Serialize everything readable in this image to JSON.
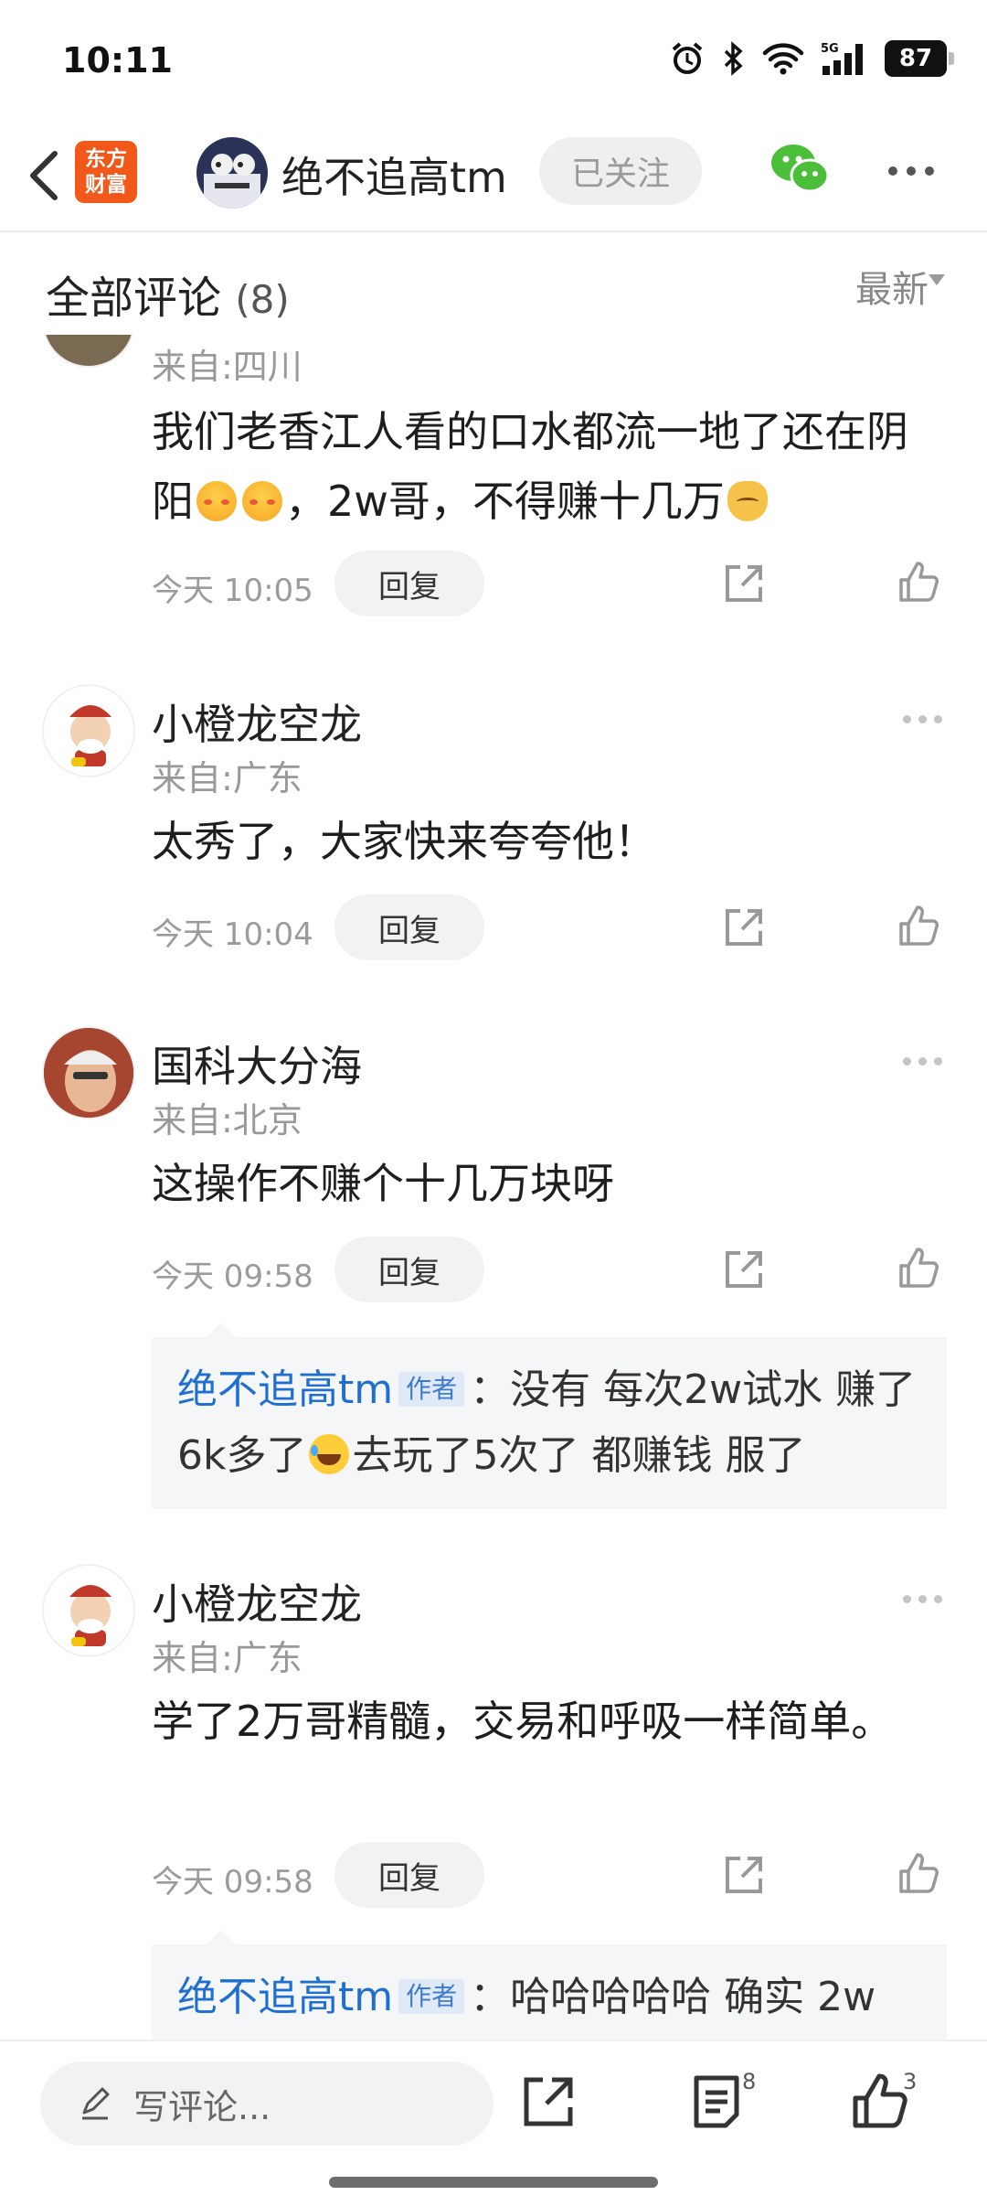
{
  "status_bar": {
    "time": "10:11",
    "network": "5G",
    "battery": "87"
  },
  "nav": {
    "app_logo_line1": "东方",
    "app_logo_line2": "财富",
    "author_name": "绝不追高tm",
    "follow_label": "已关注"
  },
  "comments_header": {
    "title": "全部评论",
    "count": "(8)",
    "sort_label": "最新"
  },
  "comments": [
    {
      "name": "",
      "location": "来自:四川",
      "text": "我们老香江人看的口水都流一地了还在阴阳",
      "text_tail": "，2w哥，不得赚十几万",
      "time": "今天 10:05",
      "reply_label": "回复"
    },
    {
      "name": "小橙龙空龙",
      "location": "来自:广东",
      "text": "太秀了，大家快来夸夸他！",
      "time": "今天 10:04",
      "reply_label": "回复"
    },
    {
      "name": "国科大分海",
      "location": "来自:北京",
      "text": "这操作不赚个十几万块呀",
      "time": "今天 09:58",
      "reply_label": "回复",
      "reply": {
        "author": "绝不追高tm",
        "tag": "作者",
        "text_a": "：没有 每次2w试水 赚了6k多了",
        "text_b": "去玩了5次了 都赚钱 服了"
      }
    },
    {
      "name": "小橙龙空龙",
      "location": "来自:广东",
      "text": "学了2万哥精髓，交易和呼吸一样简单。",
      "time": "今天 09:58",
      "reply_label": "回复",
      "reply": {
        "author": "绝不追高tm",
        "tag": "作者",
        "text_a": "：哈哈哈哈哈 确实 2w"
      }
    }
  ],
  "bottom_bar": {
    "comment_placeholder": "写评论...",
    "comment_count": "8",
    "like_count": "3"
  },
  "colors": {
    "accent_blue": "#1f6fd1",
    "brand_orange": "#f2581a",
    "wechat_green": "#4cbf3a"
  }
}
